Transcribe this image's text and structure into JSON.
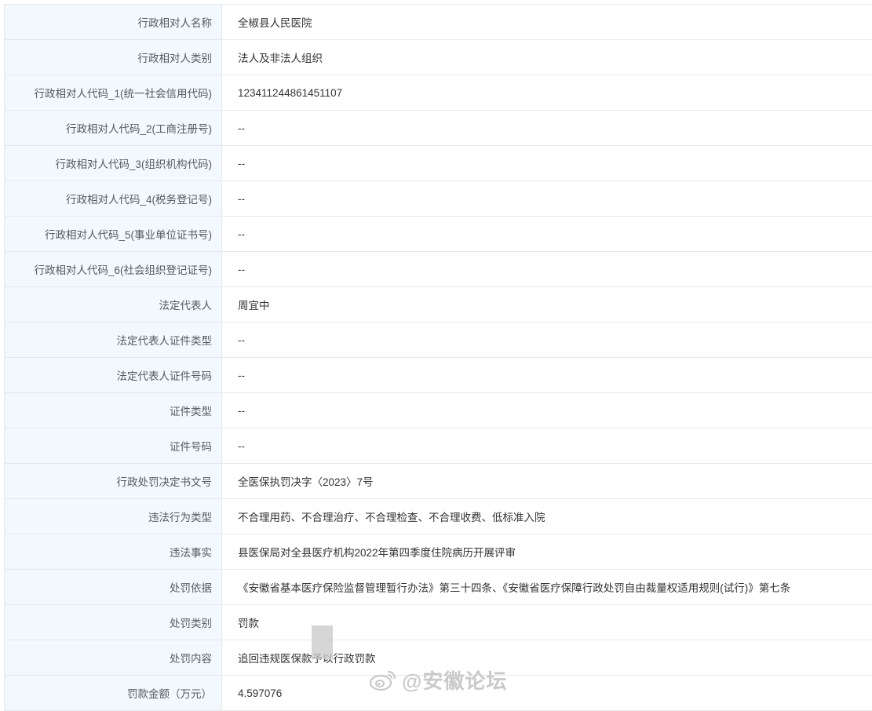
{
  "rows": [
    {
      "label": "行政相对人名称",
      "value": "全椒县人民医院"
    },
    {
      "label": "行政相对人类别",
      "value": "法人及非法人组织"
    },
    {
      "label": "行政相对人代码_1(统一社会信用代码)",
      "value": "123411244861451107"
    },
    {
      "label": "行政相对人代码_2(工商注册号)",
      "value": "--"
    },
    {
      "label": "行政相对人代码_3(组织机构代码)",
      "value": "--"
    },
    {
      "label": "行政相对人代码_4(税务登记号)",
      "value": "--"
    },
    {
      "label": "行政相对人代码_5(事业单位证书号)",
      "value": "--"
    },
    {
      "label": "行政相对人代码_6(社会组织登记证号)",
      "value": "--"
    },
    {
      "label": "法定代表人",
      "value": "周宜中"
    },
    {
      "label": "法定代表人证件类型",
      "value": "--"
    },
    {
      "label": "法定代表人证件号码",
      "value": "--"
    },
    {
      "label": "证件类型",
      "value": "--"
    },
    {
      "label": "证件号码",
      "value": "--"
    },
    {
      "label": "行政处罚决定书文号",
      "value": "全医保执罚决字〈2023〉7号"
    },
    {
      "label": "违法行为类型",
      "value": "不合理用药、不合理治疗、不合理检查、不合理收费、低标准入院"
    },
    {
      "label": "违法事实",
      "value": "县医保局对全县医疗机构2022年第四季度住院病历开展评审"
    },
    {
      "label": "处罚依据",
      "value": "《安徽省基本医疗保险监督管理暂行办法》第三十四条、《安徽省医疗保障行政处罚自由裁量权适用规则(试行)》第七条"
    },
    {
      "label": "处罚类别",
      "value": "罚款"
    },
    {
      "label": "处罚内容",
      "value": "追回违规医保款予以行政罚款"
    },
    {
      "label": "罚款金额（万元）",
      "value": "4.597076"
    }
  ],
  "watermark": {
    "text": "@安徽论坛",
    "icon": "weibo-icon"
  }
}
